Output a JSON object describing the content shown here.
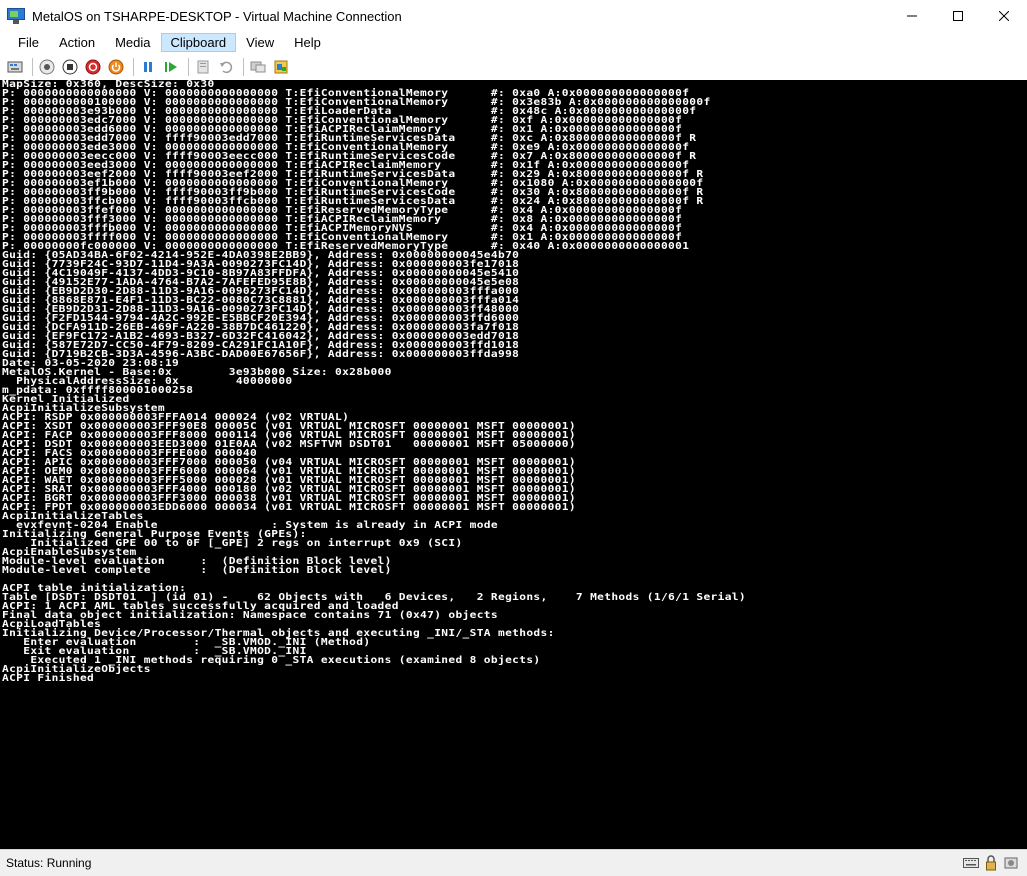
{
  "window": {
    "title": "MetalOS on TSHARPE-DESKTOP - Virtual Machine Connection",
    "minimize_glyph": "—",
    "maximize_glyph": "☐",
    "close_glyph": "✕"
  },
  "menubar": {
    "items": [
      {
        "label": "File"
      },
      {
        "label": "Action"
      },
      {
        "label": "Media"
      },
      {
        "label": "Clipboard",
        "active": true
      },
      {
        "label": "View"
      },
      {
        "label": "Help"
      }
    ]
  },
  "toolbar": {
    "icons": [
      "ctrl-alt-del-icon",
      "start-icon",
      "turn-off-icon",
      "shutdown-icon",
      "power-icon",
      "pause-icon",
      "resume-icon",
      "checkpoint-icon",
      "revert-icon",
      "enhanced-session-icon",
      "share-icon"
    ]
  },
  "console": {
    "lines": [
      "MapSize: 0x360, DescSize: 0x30",
      "P: 0000000000000000 V: 0000000000000000 T:EfiConventionalMemory      #: 0xa0 A:0x000000000000000f",
      "P: 0000000000100000 V: 0000000000000000 T:EfiConventionalMemory      #: 0x3e83b A:0x000000000000000f",
      "P: 000000003e93b000 V: 0000000000000000 T:EfiLoaderData              #: 0x48c A:0x000000000000000f",
      "P: 000000003edc7000 V: 0000000000000000 T:EfiConventionalMemory      #: 0xf A:0x000000000000000f",
      "P: 000000003edd6000 V: 0000000000000000 T:EfiACPIReclaimMemory       #: 0x1 A:0x000000000000000f",
      "P: 000000003edd7000 V: ffff90003edd7000 T:EfiRuntimeServicesData     #: 0xc A:0x800000000000000f R",
      "P: 000000003ede3000 V: 0000000000000000 T:EfiConventionalMemory      #: 0xe9 A:0x000000000000000f",
      "P: 000000003eecc000 V: ffff90003eecc000 T:EfiRuntimeServicesCode     #: 0x7 A:0x800000000000000f R",
      "P: 000000003eed3000 V: 0000000000000000 T:EfiACPIReclaimMemory       #: 0x1f A:0x000000000000000f",
      "P: 000000003eef2000 V: ffff90003eef2000 T:EfiRuntimeServicesData     #: 0x29 A:0x800000000000000f R",
      "P: 000000003ef1b000 V: 0000000000000000 T:EfiConventionalMemory      #: 0x1080 A:0x000000000000000f",
      "P: 000000003ff9b000 V: ffff90003ff9b000 T:EfiRuntimeServicesCode     #: 0x30 A:0x800000000000000f R",
      "P: 000000003ffcb000 V: ffff90003ffcb000 T:EfiRuntimeServicesData     #: 0x24 A:0x800000000000000f R",
      "P: 000000003ffef000 V: 0000000000000000 T:EfiReservedMemoryType      #: 0x4 A:0x000000000000000f",
      "P: 000000003fff3000 V: 0000000000000000 T:EfiACPIReclaimMemory       #: 0x8 A:0x000000000000000f",
      "P: 000000003fffb000 V: 0000000000000000 T:EfiACPIMemoryNVS           #: 0x4 A:0x000000000000000f",
      "P: 000000003ffff000 V: 0000000000000000 T:EfiConventionalMemory      #: 0x1 A:0x000000000000000f",
      "P: 00000000fc000000 V: 0000000000000000 T:EfiReservedMemoryType      #: 0x40 A:0x0000000000000001",
      "Guid: {05AD34BA-6F02-4214-952E-4DA0398E2BB9}, Address: 0x00000000045e4b70",
      "Guid: {7739F24C-93D7-11D4-9A3A-0090273FC14D}, Address: 0x000000003fe17018",
      "Guid: {4C19049F-4137-4DD3-9C10-8B97A83FFDFA}, Address: 0x00000000045e5410",
      "Guid: {49152E77-1ADA-4764-B7A2-7AFEFED95E8B}, Address: 0x00000000045e5e08",
      "Guid: {EB9D2D30-2D88-11D3-9A16-0090273FC14D}, Address: 0x000000003fffa000",
      "Guid: {8868E871-E4F1-11D3-BC22-0080C73C8881}, Address: 0x000000003fffa014",
      "Guid: {EB9D2D31-2D88-11D3-9A16-0090273FC14D}, Address: 0x000000003ff48000",
      "Guid: {F2FD1544-9794-4A2C-992E-E5BBCF20E394}, Address: 0x000000003ffd6000",
      "Guid: {DCFA911D-26EB-469F-A220-38B7DC461220}, Address: 0x000000003fa7f018",
      "Guid: {EF9FC172-A1B2-4693-B327-6D32FC416042}, Address: 0x000000003edd7018",
      "Guid: {587E72D7-CC50-4F79-8209-CA291FC1A10F}, Address: 0x000000003ffd1018",
      "Guid: {D719B2CB-3D3A-4596-A3BC-DAD00E67656F}, Address: 0x000000003ffda998",
      "Date: 03-05-2020 23:08:19",
      "MetalOS.Kernel - Base:0x        3e93b000 Size: 0x28b000",
      "  PhysicalAddressSize: 0x        40000000",
      "m_pdata: 0xffff800001000258",
      "Kernel Initialized",
      "AcpiInitializeSubsystem",
      "ACPI: RSDP 0x000000003FFFA014 000024 (v02 VRTUAL)",
      "ACPI: XSDT 0x000000003FFF90E8 00005C (v01 VRTUAL MICROSFT 00000001 MSFT 00000001)",
      "ACPI: FACP 0x000000003FFF8000 000114 (v06 VRTUAL MICROSFT 00000001 MSFT 00000001)",
      "ACPI: DSDT 0x000000003EED3000 01E0AA (v02 MSFTVM DSDT01   00000001 MSFT 05000000)",
      "ACPI: FACS 0x000000003FFFE000 000040",
      "ACPI: APIC 0x000000003FFF7000 000050 (v04 VRTUAL MICROSFT 00000001 MSFT 00000001)",
      "ACPI: OEM0 0x000000003FFF6000 000064 (v01 VRTUAL MICROSFT 00000001 MSFT 00000001)",
      "ACPI: WAET 0x000000003FFF5000 000028 (v01 VRTUAL MICROSFT 00000001 MSFT 00000001)",
      "ACPI: SRAT 0x000000003FFF4000 000180 (v02 VRTUAL MICROSFT 00000001 MSFT 00000001)",
      "ACPI: BGRT 0x000000003FFF3000 000038 (v01 VRTUAL MICROSFT 00000001 MSFT 00000001)",
      "ACPI: FPDT 0x000000003EDD6000 000034 (v01 VRTUAL MICROSFT 00000001 MSFT 00000001)",
      "AcpiInitializeTables",
      "  evxfevnt-0204 Enable                : System is already in ACPI mode",
      "Initializing General Purpose Events (GPEs):",
      "    Initialized GPE 00 to 0F [_GPE] 2 regs on interrupt 0x9 (SCI)",
      "AcpiEnableSubsystem",
      "Module-level evaluation     :  (Definition Block level)",
      "Module-level complete       :  (Definition Block level)",
      "",
      "ACPI table initialization:",
      "Table [DSDT: DSDT01  ] (id 01) -    62 Objects with   6 Devices,   2 Regions,    7 Methods (1/6/1 Serial)",
      "ACPI: 1 ACPI AML tables successfully acquired and loaded",
      "Final data object initialization: Namespace contains 71 (0x47) objects",
      "AcpiLoadTables",
      "Initializing Device/Processor/Thermal objects and executing _INI/_STA methods:",
      "   Enter evaluation        :  _SB.VMOD._INI (Method)",
      "   Exit evaluation         :  _SB.VMOD._INI",
      "    Executed 1 _INI methods requiring 0 _STA executions (examined 8 objects)",
      "AcpiInitializeObjects",
      "ACPI Finished"
    ]
  },
  "status": {
    "text": "Status: Running"
  },
  "colors": {
    "console_bg": "#000000",
    "console_fg": "#ffffff",
    "menu_active_bg": "#cce8ff"
  }
}
